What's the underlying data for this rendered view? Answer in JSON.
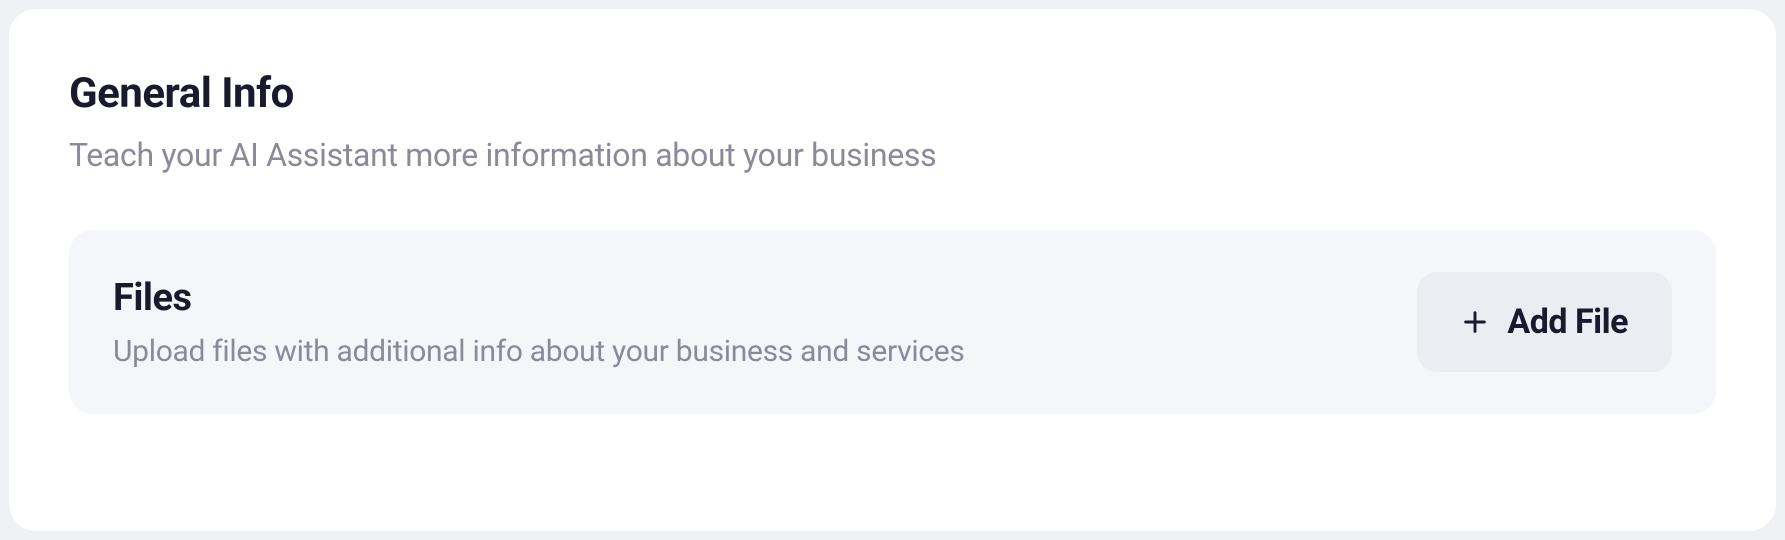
{
  "header": {
    "title": "General Info",
    "subtitle": "Teach your AI Assistant more information about your business"
  },
  "files": {
    "title": "Files",
    "subtitle": "Upload files with additional info about your business and services",
    "add_button_label": "Add File"
  }
}
